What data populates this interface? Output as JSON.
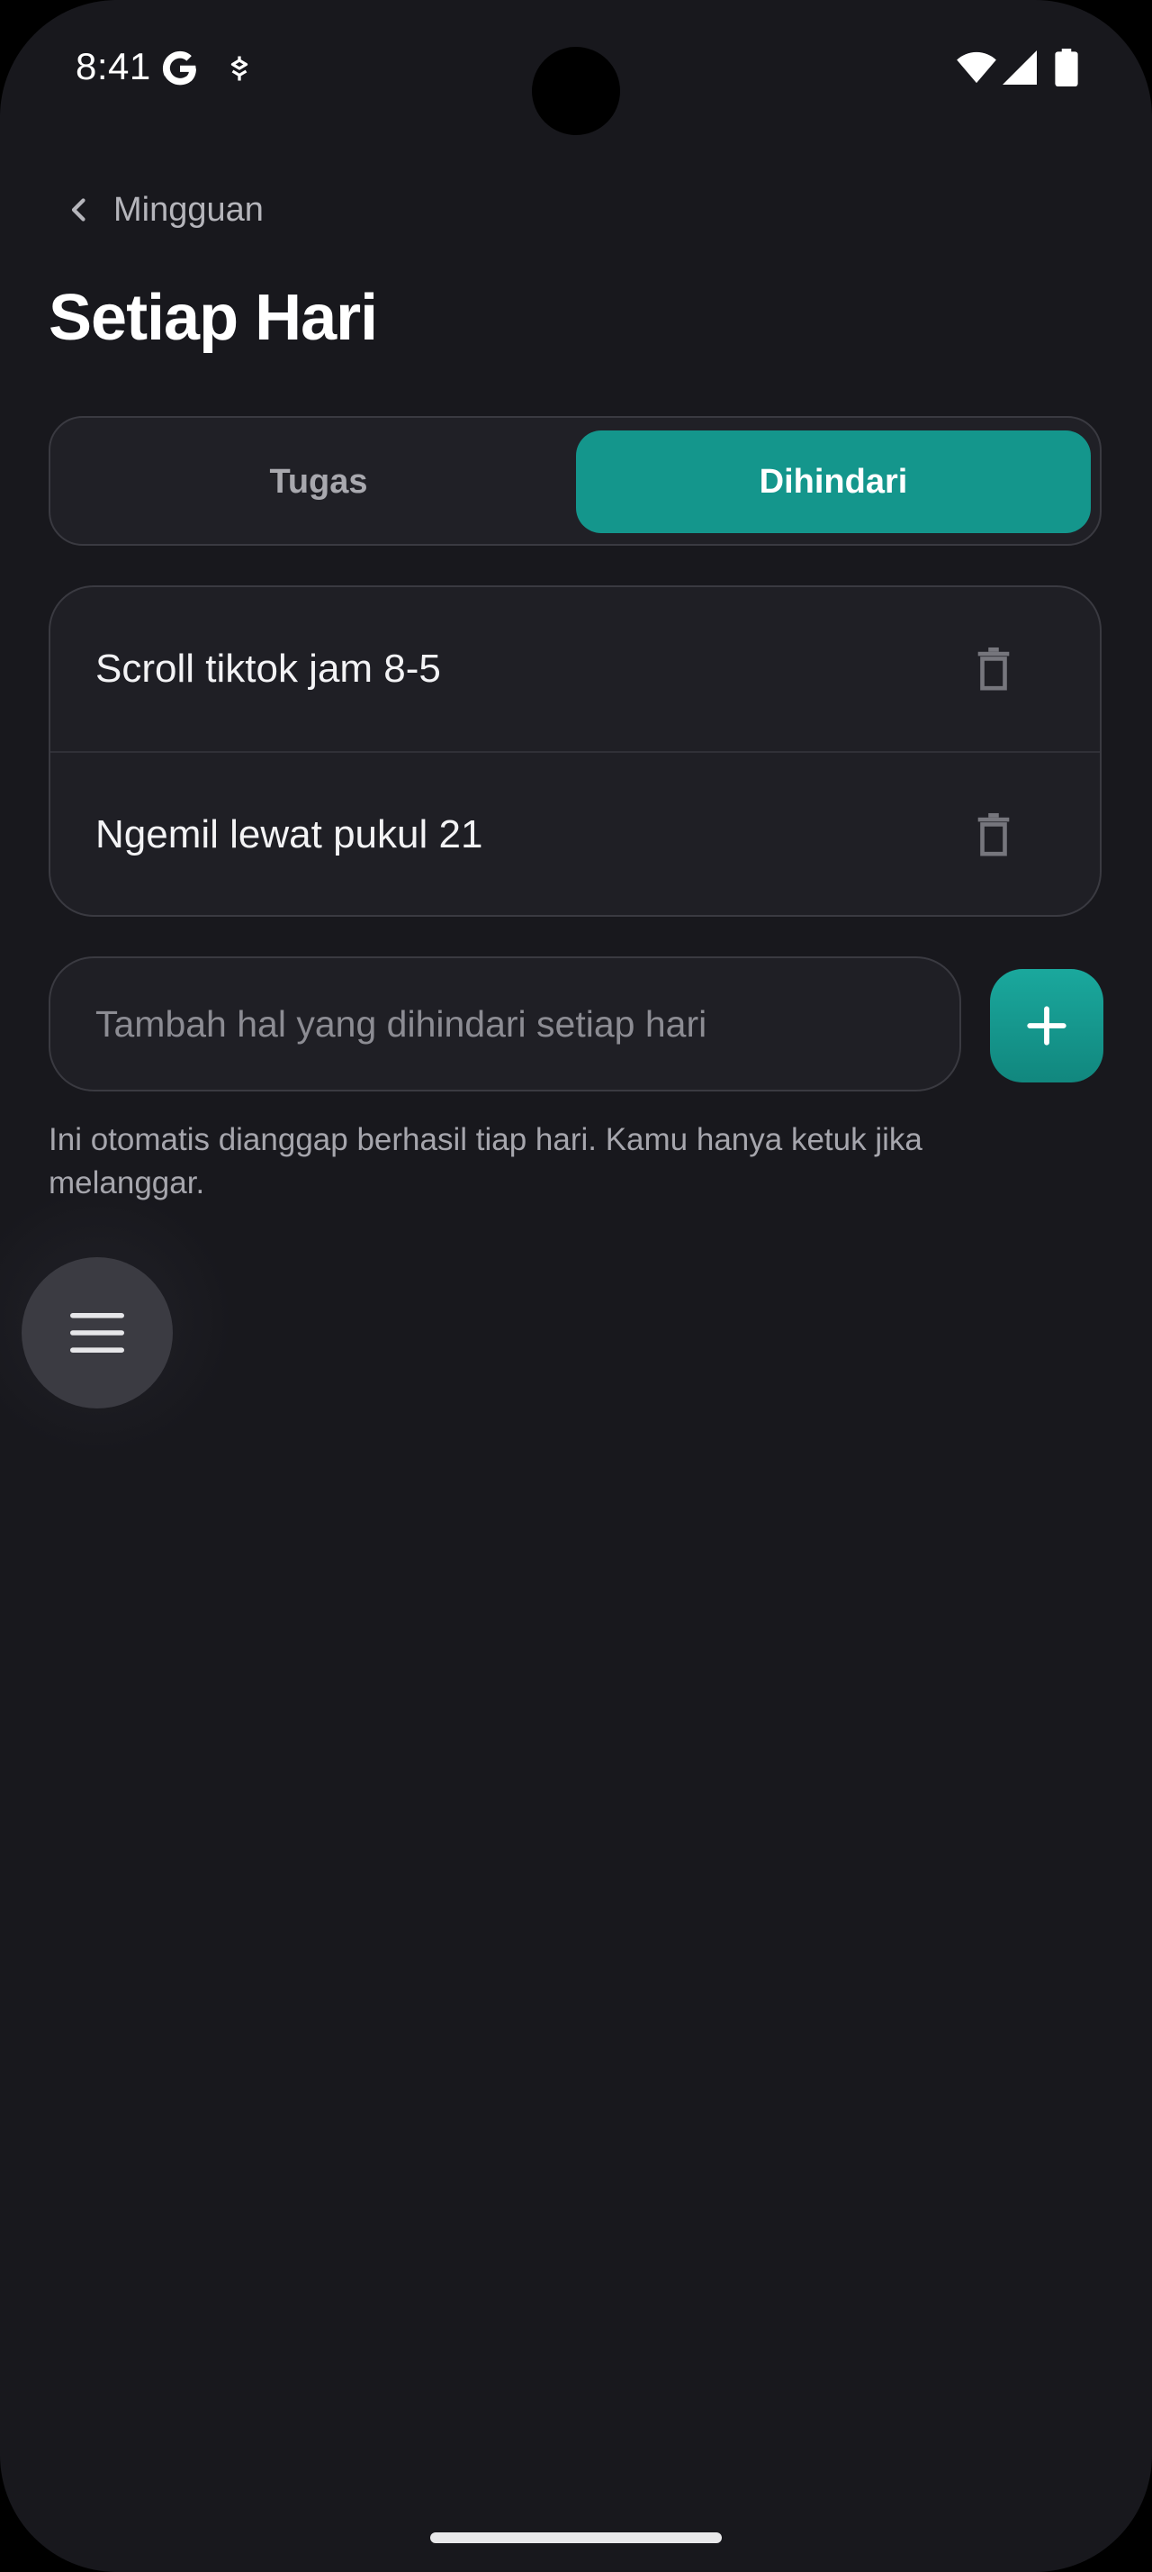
{
  "status_bar": {
    "time": "8:41"
  },
  "nav": {
    "back_label": "Mingguan"
  },
  "page": {
    "title": "Setiap Hari"
  },
  "tabs": [
    {
      "label": "Tugas",
      "selected": false
    },
    {
      "label": "Dihindari",
      "selected": true
    }
  ],
  "avoid_items": [
    {
      "label": "Scroll tiktok jam 8-5"
    },
    {
      "label": "Ngemil lewat pukul 21"
    }
  ],
  "add_field": {
    "placeholder": "Tambah hal yang dihindari setiap hari",
    "value": ""
  },
  "helper": {
    "text": "Ini otomatis dianggap berhasil tiap hari. Kamu hanya ketuk jika melanggar."
  },
  "icons": {
    "back": "chevron-left-icon",
    "delete": "trash-icon",
    "add": "plus-icon",
    "menu": "hamburger-menu-icon"
  },
  "colors": {
    "background": "#18181d",
    "accent": "#14968c",
    "card": "#1f1f25",
    "border": "#3a3a41"
  }
}
